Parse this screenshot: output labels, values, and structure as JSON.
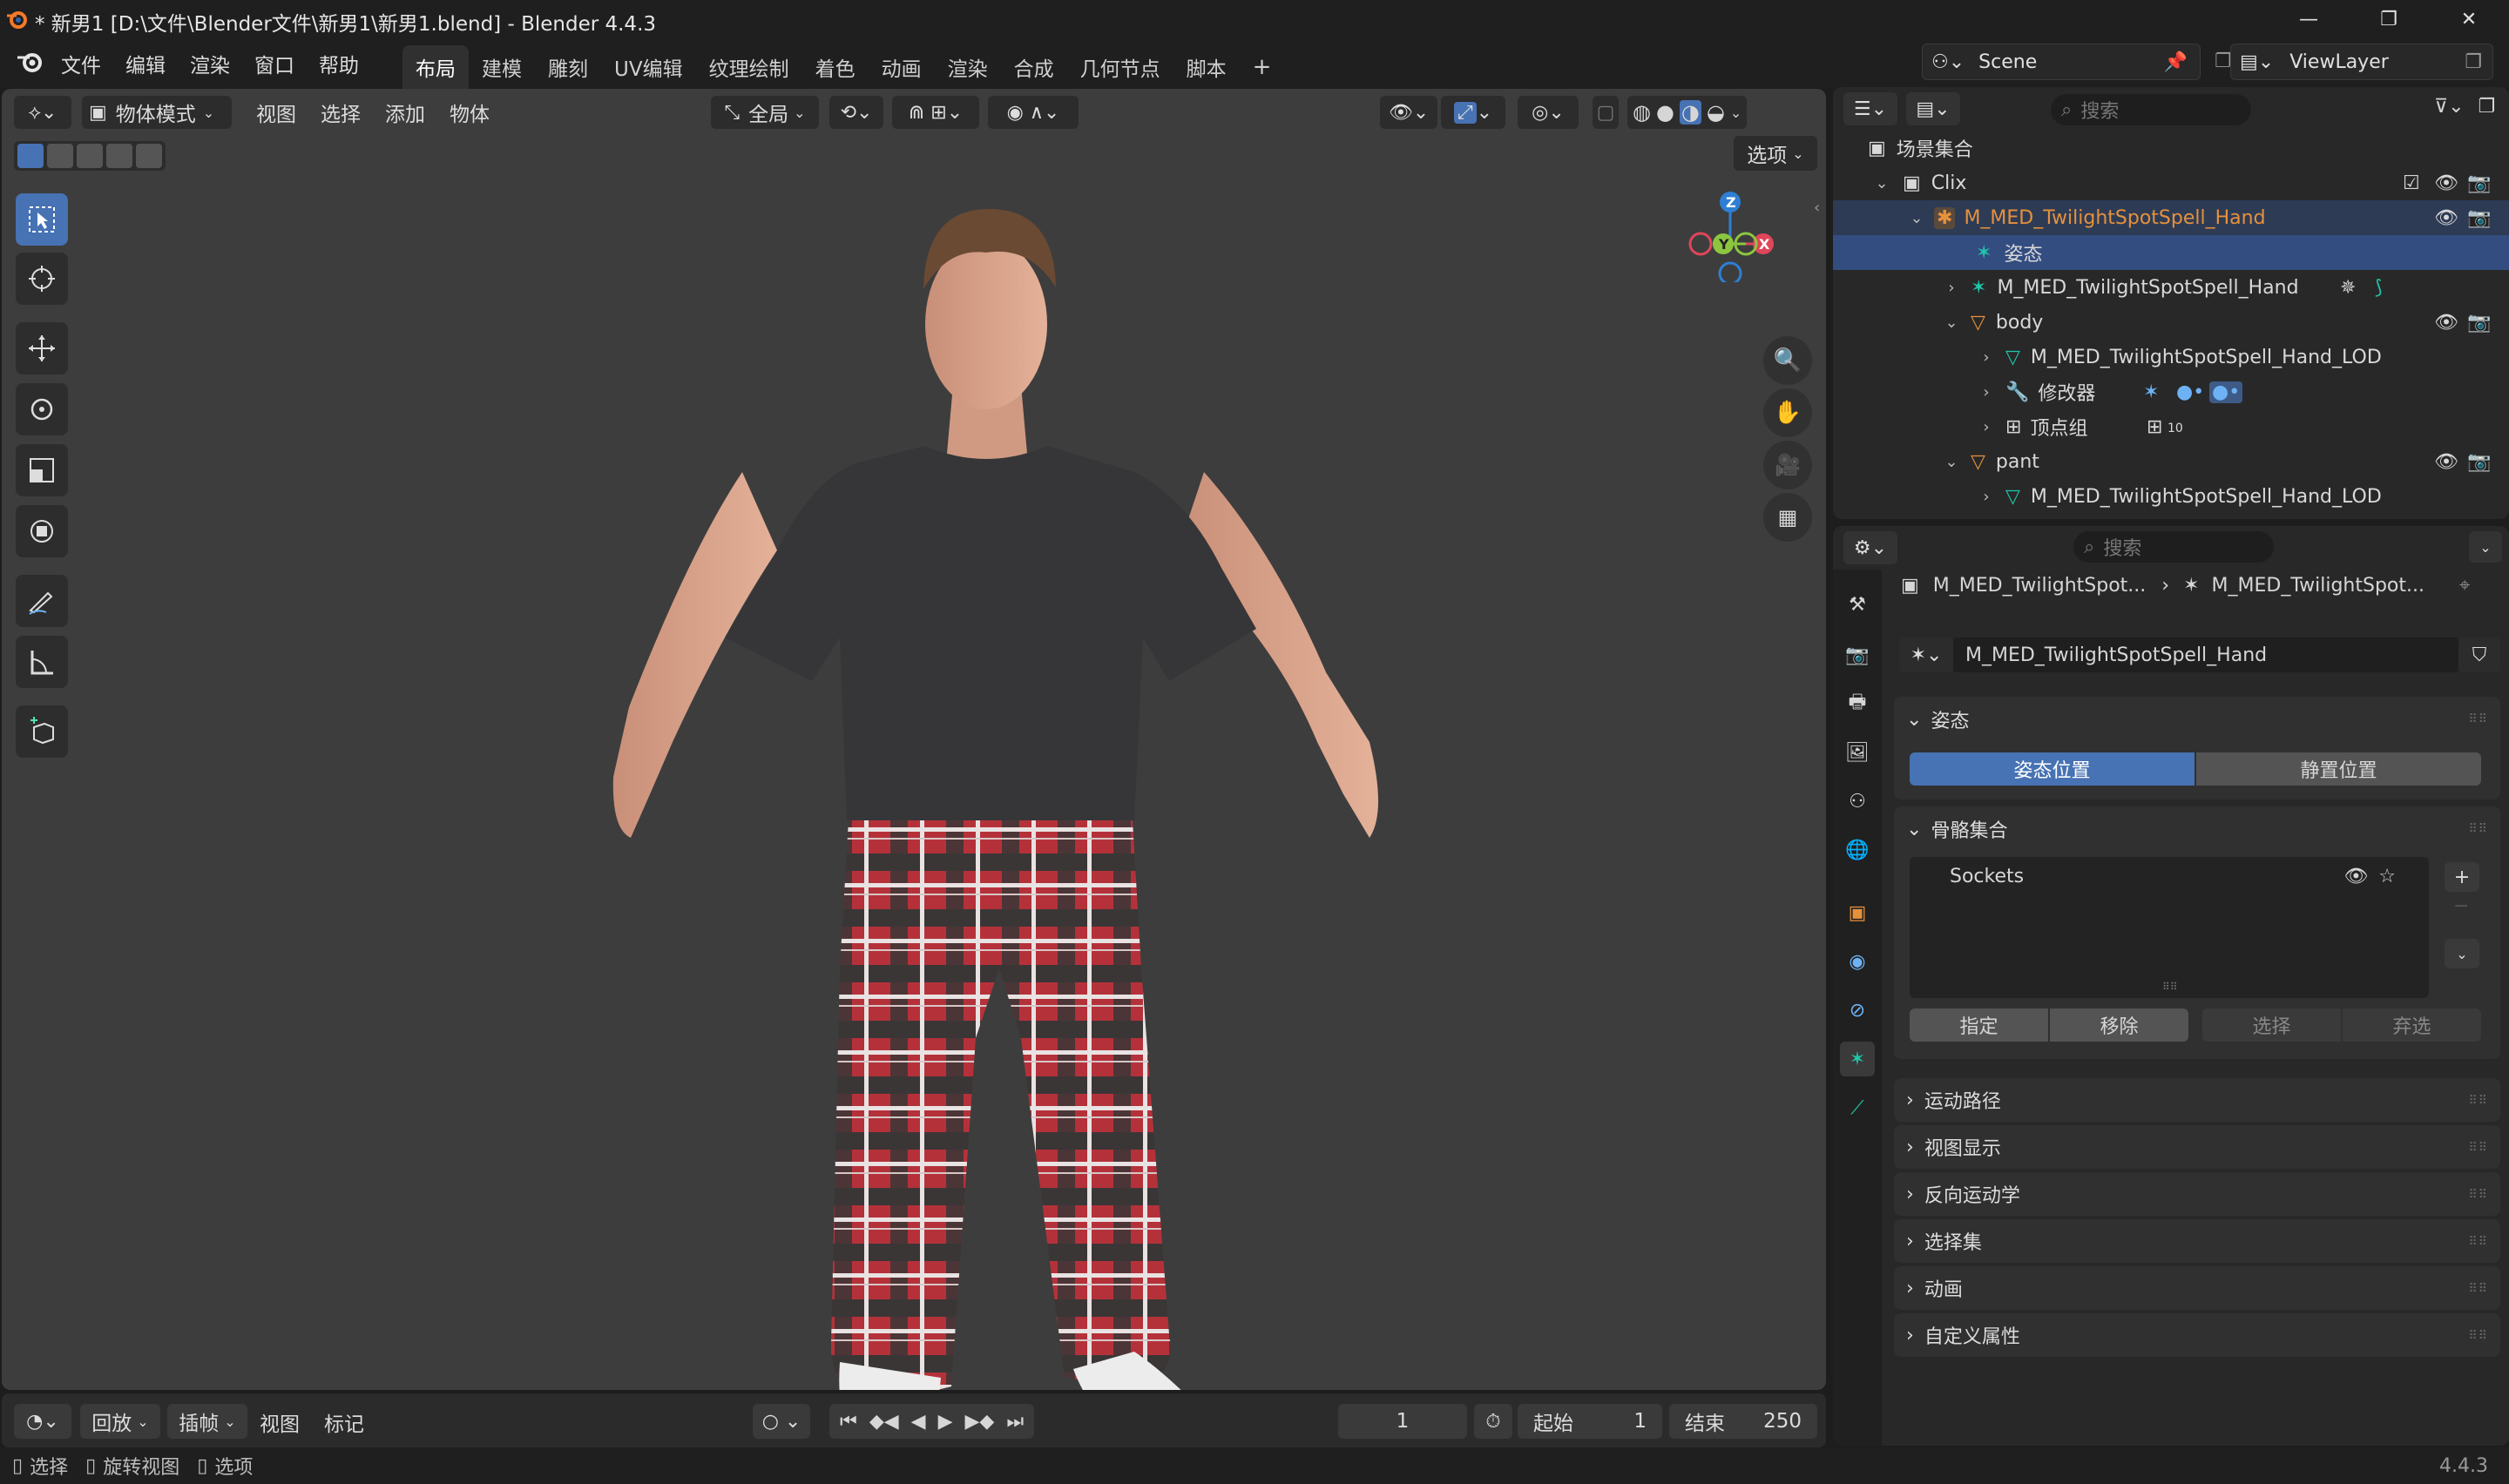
{
  "window": {
    "title": "* 新男1 [D:\\文件\\Blender文件\\新男1\\新男1.blend] - Blender 4.4.3",
    "minimize": "—",
    "maximize": "❐",
    "close": "✕"
  },
  "menu": [
    "文件",
    "编辑",
    "渲染",
    "窗口",
    "帮助"
  ],
  "workspaces": [
    "布局",
    "建模",
    "雕刻",
    "UV编辑",
    "纹理绘制",
    "着色",
    "动画",
    "渲染",
    "合成",
    "几何节点",
    "脚本"
  ],
  "workspace_add": "+",
  "scene": {
    "value": "Scene"
  },
  "view_layer": {
    "value": "ViewLayer"
  },
  "viewport": {
    "mode": "物体模式",
    "menus": [
      "视图",
      "选择",
      "添加",
      "物体"
    ],
    "orientation": "全局",
    "options": "选项",
    "gizmo": {
      "z": "Z",
      "y": "Y",
      "x": "X"
    },
    "background": "#3d3d3d"
  },
  "outliner": {
    "search_placeholder": "搜索",
    "root": "场景集合",
    "rows": [
      {
        "label": "Clix"
      },
      {
        "label": "M_MED_TwilightSpotSpell_Hand"
      },
      {
        "label": "姿态"
      },
      {
        "label": "M_MED_TwilightSpotSpell_Hand"
      },
      {
        "label": "body"
      },
      {
        "label": "M_MED_TwilightSpotSpell_Hand_LOD"
      },
      {
        "label": "修改器"
      },
      {
        "label": "顶点组"
      },
      {
        "label": "pant"
      },
      {
        "label": "M_MED_TwilightSpotSpell_Hand_LOD"
      }
    ],
    "vgroup_count": "10"
  },
  "properties": {
    "search_placeholder": "搜索",
    "breadcrumb": [
      "M_MED_TwilightSpot...",
      "M_MED_TwilightSpot..."
    ],
    "data_name": "M_MED_TwilightSpotSpell_Hand",
    "pose_panel": "姿态",
    "pose_position": "姿态位置",
    "rest_position": "静置位置",
    "bone_collections": "骨骼集合",
    "collection_item": "Sockets",
    "assign": "指定",
    "remove": "移除",
    "select": "选择",
    "deselect": "弃选",
    "collapsed": [
      "运动路径",
      "视图显示",
      "反向运动学",
      "选择集",
      "动画",
      "自定义属性"
    ]
  },
  "timeline": {
    "playback": "回放",
    "keying": "插帧",
    "view": "视图",
    "marker": "标记",
    "current_frame": "1",
    "start_label": "起始",
    "start": "1",
    "end_label": "结束",
    "end": "250"
  },
  "status": {
    "select": "选择",
    "rotate": "旋转视图",
    "options": "选项",
    "version": "4.4.3"
  },
  "colors": {
    "accent": "#4772b3",
    "selected_row": "#334d80",
    "armature": "#1fc6a8",
    "mesh": "#e5913c"
  }
}
